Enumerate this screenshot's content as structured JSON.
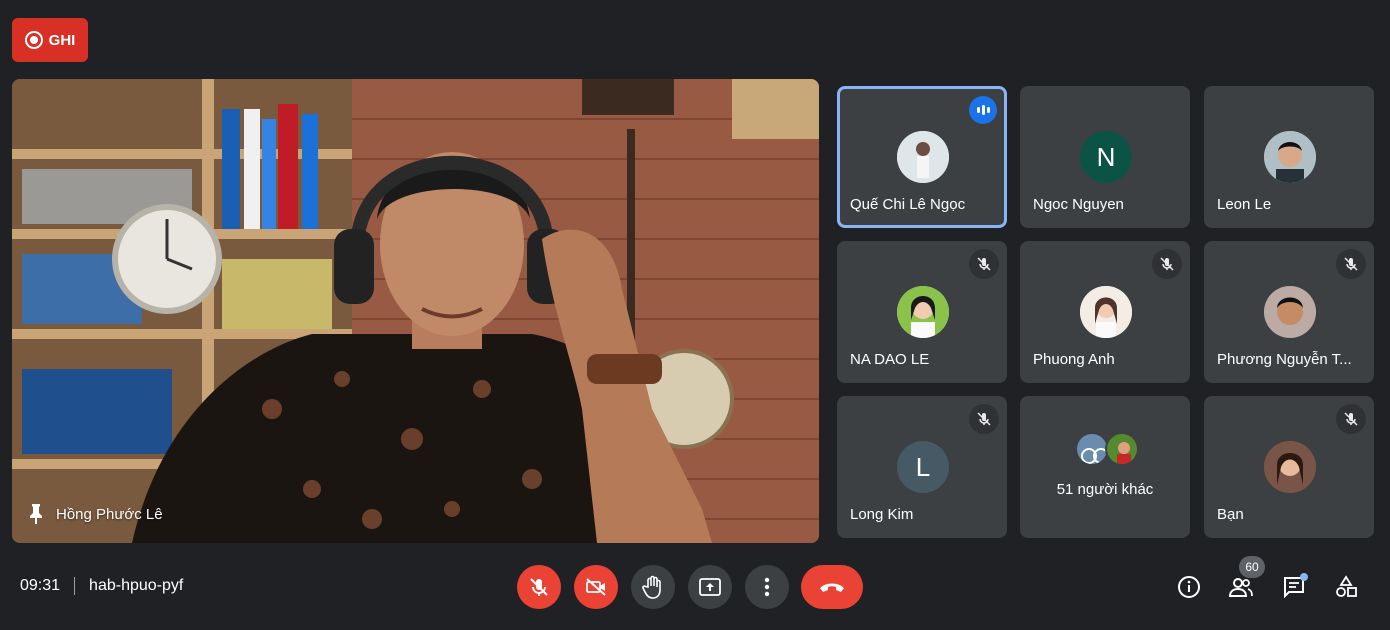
{
  "recording": {
    "label": "GHI"
  },
  "main_speaker": {
    "name": "Hồng Phước Lê"
  },
  "participants": [
    {
      "name": "Quế Chi Lê Ngọc",
      "speaking": true,
      "muted": false,
      "avatar": "photo"
    },
    {
      "name": "Ngoc Nguyen",
      "speaking": false,
      "muted": false,
      "avatar_letter": "N",
      "avatar_color": "#0b5345"
    },
    {
      "name": "Leon Le",
      "speaking": false,
      "muted": false,
      "avatar": "photo"
    },
    {
      "name": "NA DAO LE",
      "muted": true,
      "avatar": "photo"
    },
    {
      "name": "Phuong Anh",
      "muted": true,
      "avatar": "photo"
    },
    {
      "name": "Phương Nguyễn T...",
      "muted": true,
      "avatar": "photo"
    },
    {
      "name": "Long Kim",
      "muted": true,
      "avatar_letter": "L",
      "avatar_color": "#455a64"
    },
    {
      "others_label": "51 người khác"
    },
    {
      "name": "Bạn",
      "muted": true,
      "avatar": "photo"
    }
  ],
  "meeting": {
    "time": "09:31",
    "code": "hab-hpuo-pyf"
  },
  "controls": [
    "mic-off",
    "camera-off",
    "raise-hand",
    "present",
    "more-options",
    "leave-call"
  ],
  "right_tools": {
    "people_count": "60",
    "icons": [
      "info-icon",
      "people-icon",
      "chat-icon",
      "activities-icon"
    ]
  },
  "colors": {
    "background": "#202124",
    "tile": "#3c4043",
    "red": "#ea4335",
    "accent": "#8ab4f8"
  }
}
